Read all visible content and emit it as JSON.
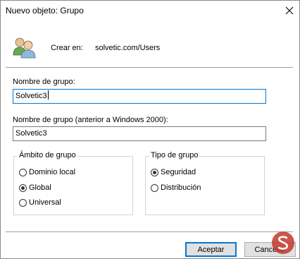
{
  "window": {
    "title": "Nuevo objeto: Grupo",
    "close_icon": "close-icon"
  },
  "header": {
    "icon": "users-group-icon",
    "create_in_label": "Crear en:",
    "create_in_value": "solvetic.com/Users"
  },
  "fields": {
    "group_name_label": "Nombre de grupo:",
    "group_name_value": "Solvetic3",
    "group_name_pre2000_label": "Nombre de grupo (anterior a Windows 2000):",
    "group_name_pre2000_value": "Solvetic3"
  },
  "scope": {
    "legend": "Ámbito de grupo",
    "options": [
      {
        "label": "Dominio local",
        "checked": false
      },
      {
        "label": "Global",
        "checked": true
      },
      {
        "label": "Universal",
        "checked": false
      }
    ]
  },
  "type": {
    "legend": "Tipo de grupo",
    "options": [
      {
        "label": "Seguridad",
        "checked": true
      },
      {
        "label": "Distribución",
        "checked": false
      }
    ]
  },
  "buttons": {
    "accept_label": "Aceptar",
    "cancel_label": "Cancelar"
  },
  "colors": {
    "focus_accent": "#0078d7",
    "watermark": "#c0392b"
  }
}
